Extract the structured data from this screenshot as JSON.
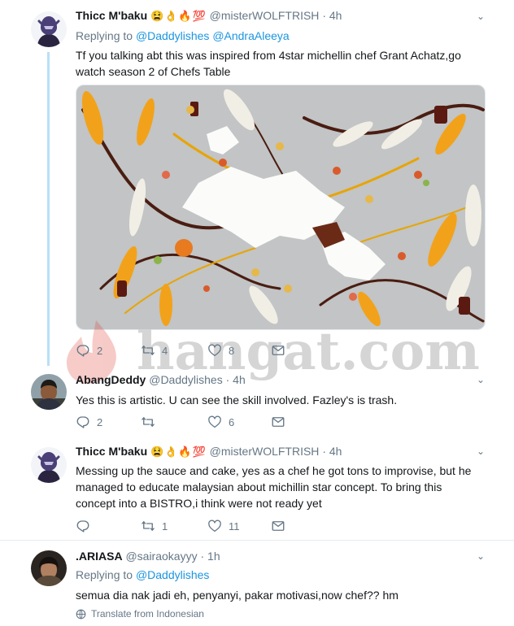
{
  "tweets": [
    {
      "name": "Thicc M'baku",
      "emojis": "😫👌🔥💯",
      "handle": "@misterWOLFTRISH",
      "time": "4h",
      "replying_prefix": "Replying to",
      "replying_to": [
        "@Daddylishes",
        "@AndraAleeya"
      ],
      "text": "Tf you talking abt this was inspired from 4star michellin chef Grant Achatz,go watch season 2 of Chefs Table",
      "replies": "2",
      "retweets": "4",
      "likes": "8"
    },
    {
      "name": "AbangDeddy",
      "handle": "@Daddylishes",
      "time": "4h",
      "text": "Yes this is artistic. U can see the skill involved. Fazley's is trash.",
      "replies": "2",
      "retweets": "",
      "likes": "6"
    },
    {
      "name": "Thicc M'baku",
      "emojis": "😫👌🔥💯",
      "handle": "@misterWOLFTRISH",
      "time": "4h",
      "text": "Messing up the sauce and cake, yes as a chef he got tons to improvise, but he managed to educate malaysian about michillin star concept. To bring this concept into a BISTRO,i think were not ready yet",
      "replies": "",
      "retweets": "1",
      "likes": "11"
    },
    {
      "name": ".ARIASA",
      "handle": "@sairaokayyy",
      "time": "1h",
      "replying_prefix": "Replying to",
      "replying_to": [
        "@Daddylishes"
      ],
      "text": "semua dia nak jadi eh, penyanyi, pakar motivasi,now chef?? hm",
      "translate": "Translate from Indonesian"
    }
  ],
  "watermark": "hangat.com",
  "colors": {
    "accent": "#1b95e0",
    "muted": "#657786",
    "thread": "#b8e0f7",
    "divider": "#e6ecf0"
  },
  "icons": [
    "caret-down-icon",
    "reply-icon",
    "retweet-icon",
    "heart-icon",
    "dm-icon",
    "globe-icon"
  ]
}
